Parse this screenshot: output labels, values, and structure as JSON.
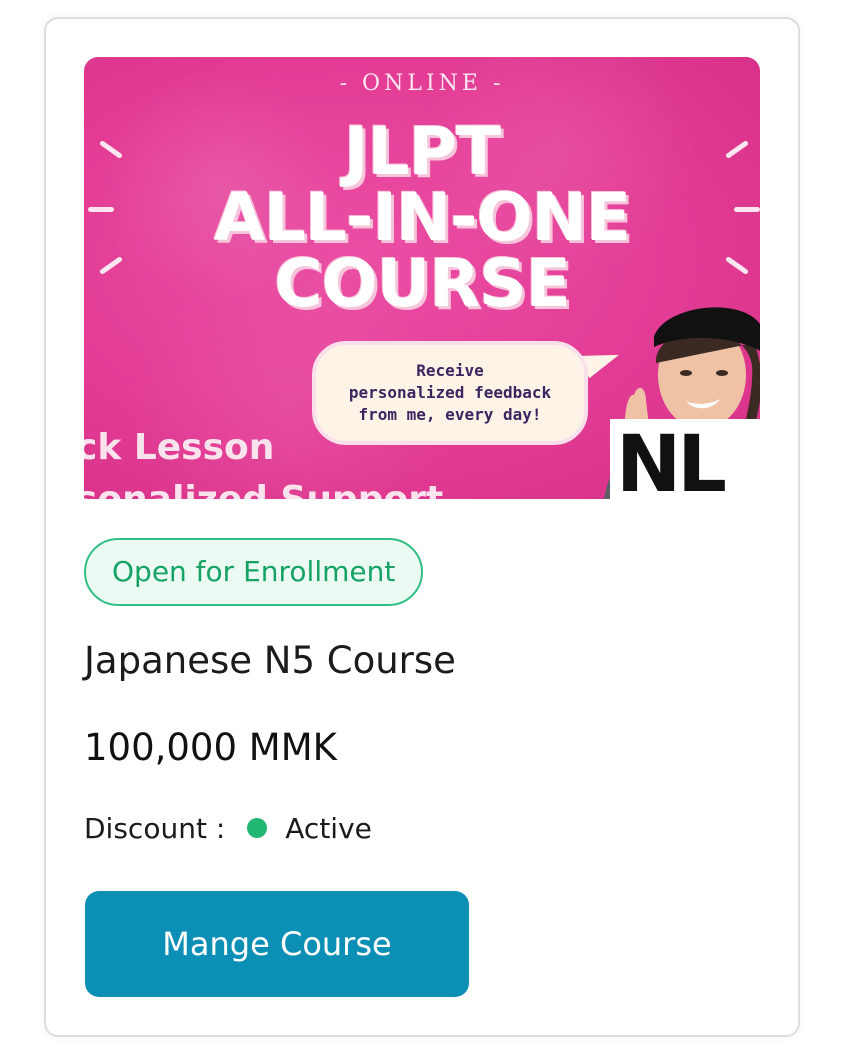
{
  "banner": {
    "kicker": "- ONLINE -",
    "headline": [
      "JLPT",
      "ALL-IN-ONE",
      "COURSE"
    ],
    "bubble_lines": [
      "Receive",
      "personalized feedback",
      "from me, every day!"
    ],
    "side_lines": [
      "ck Lesson",
      "sonalized Support"
    ],
    "badge_text": "NL"
  },
  "course": {
    "status": "Open for Enrollment",
    "title": "Japanese N5 Course",
    "price": "100,000 MMK",
    "discount_label": "Discount :",
    "discount_status": "Active"
  },
  "actions": {
    "manage_label": "Mange Course"
  },
  "colors": {
    "accent": "#0c8fb4",
    "status_green": "#22b873",
    "banner_pink": "#e33c95"
  }
}
